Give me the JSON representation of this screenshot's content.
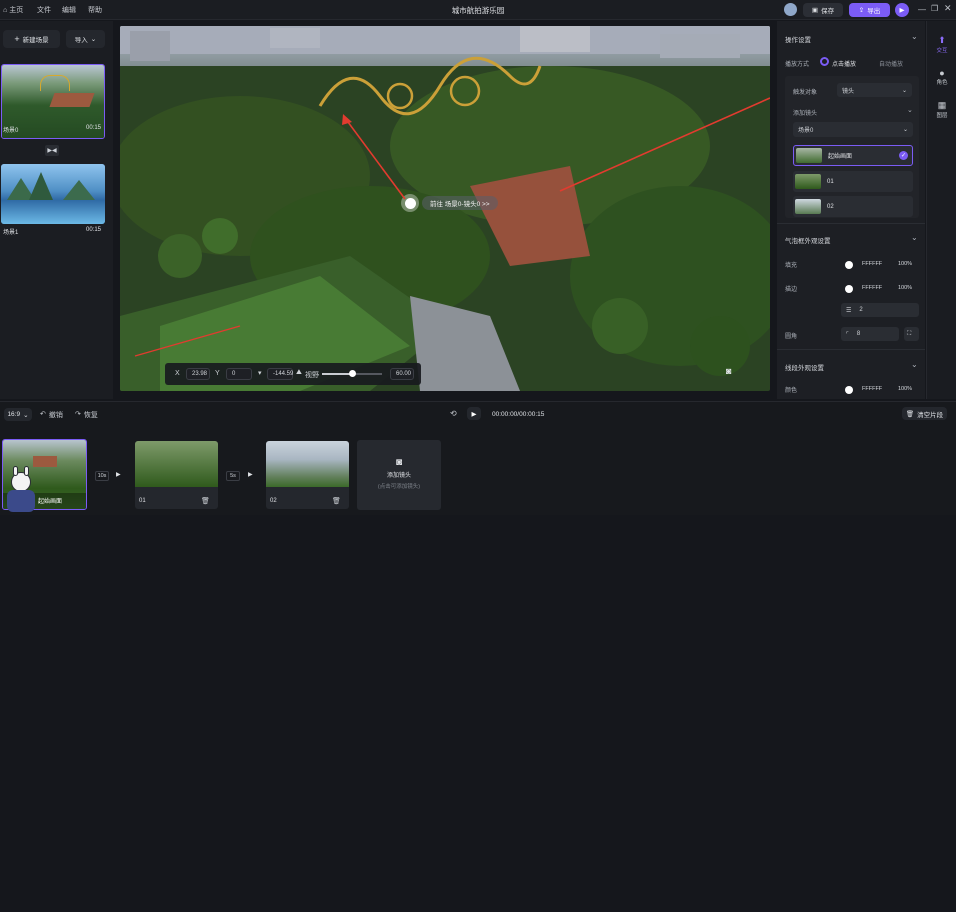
{
  "topbar": {
    "home": "主页",
    "menu_file": "文件",
    "menu_edit": "编辑",
    "menu_help": "帮助",
    "title": "城市航拍游乐园",
    "save": "保存",
    "export": "导出"
  },
  "left": {
    "new_scene": "新建场景",
    "import": "导入",
    "scenes": [
      {
        "name": "场景0",
        "duration": "00:15"
      },
      {
        "name": "场景1",
        "duration": "00:15"
      }
    ]
  },
  "viewer": {
    "hotspot_label": "前往 场景0-镜头0 >>",
    "x_label": "X",
    "x_value": "23.98",
    "y_label": "Y",
    "y_value": "0",
    "z_value": "-144.59",
    "fov_label": "视野",
    "fov_value": "60.00"
  },
  "right": {
    "op_settings": "操作设置",
    "play_mode_label": "播放方式",
    "play_click": "点击播放",
    "play_auto": "自动播放",
    "trigger_label": "触发对象",
    "trigger_value": "镜头",
    "add_shot": "添加镜头",
    "scene_select": "场景0",
    "shots": [
      "起始画面",
      "01",
      "02"
    ],
    "bubble_title": "气泡框外观设置",
    "fill_label": "填充",
    "fill_color": "FFFFFF",
    "fill_pct": "100%",
    "stroke_label": "描边",
    "stroke_color": "FFFFFF",
    "stroke_pct": "100%",
    "stroke_width": "2",
    "radius_label": "圆角",
    "radius_value": "8",
    "line_title": "线段外观设置",
    "line_color_label": "颜色",
    "line_color": "FFFFFF",
    "line_pct": "100%"
  },
  "rail": {
    "interact": "交互",
    "character": "角色",
    "layers": "图层"
  },
  "timeline": {
    "ratio": "16:9",
    "undo": "撤销",
    "redo": "恢复",
    "time": "00:00:00/00:00:15",
    "clear": "清空片段",
    "clips": [
      {
        "name": "起始画面"
      },
      {
        "name": "01"
      },
      {
        "name": "02"
      }
    ],
    "gap1": "10s",
    "gap2": "5s",
    "add_shot": "添加镜头",
    "add_shot_hint": "(点击可添加镜头)"
  },
  "colors": {
    "accent": "#7b5cf5",
    "arrow": "#e23b2f"
  }
}
